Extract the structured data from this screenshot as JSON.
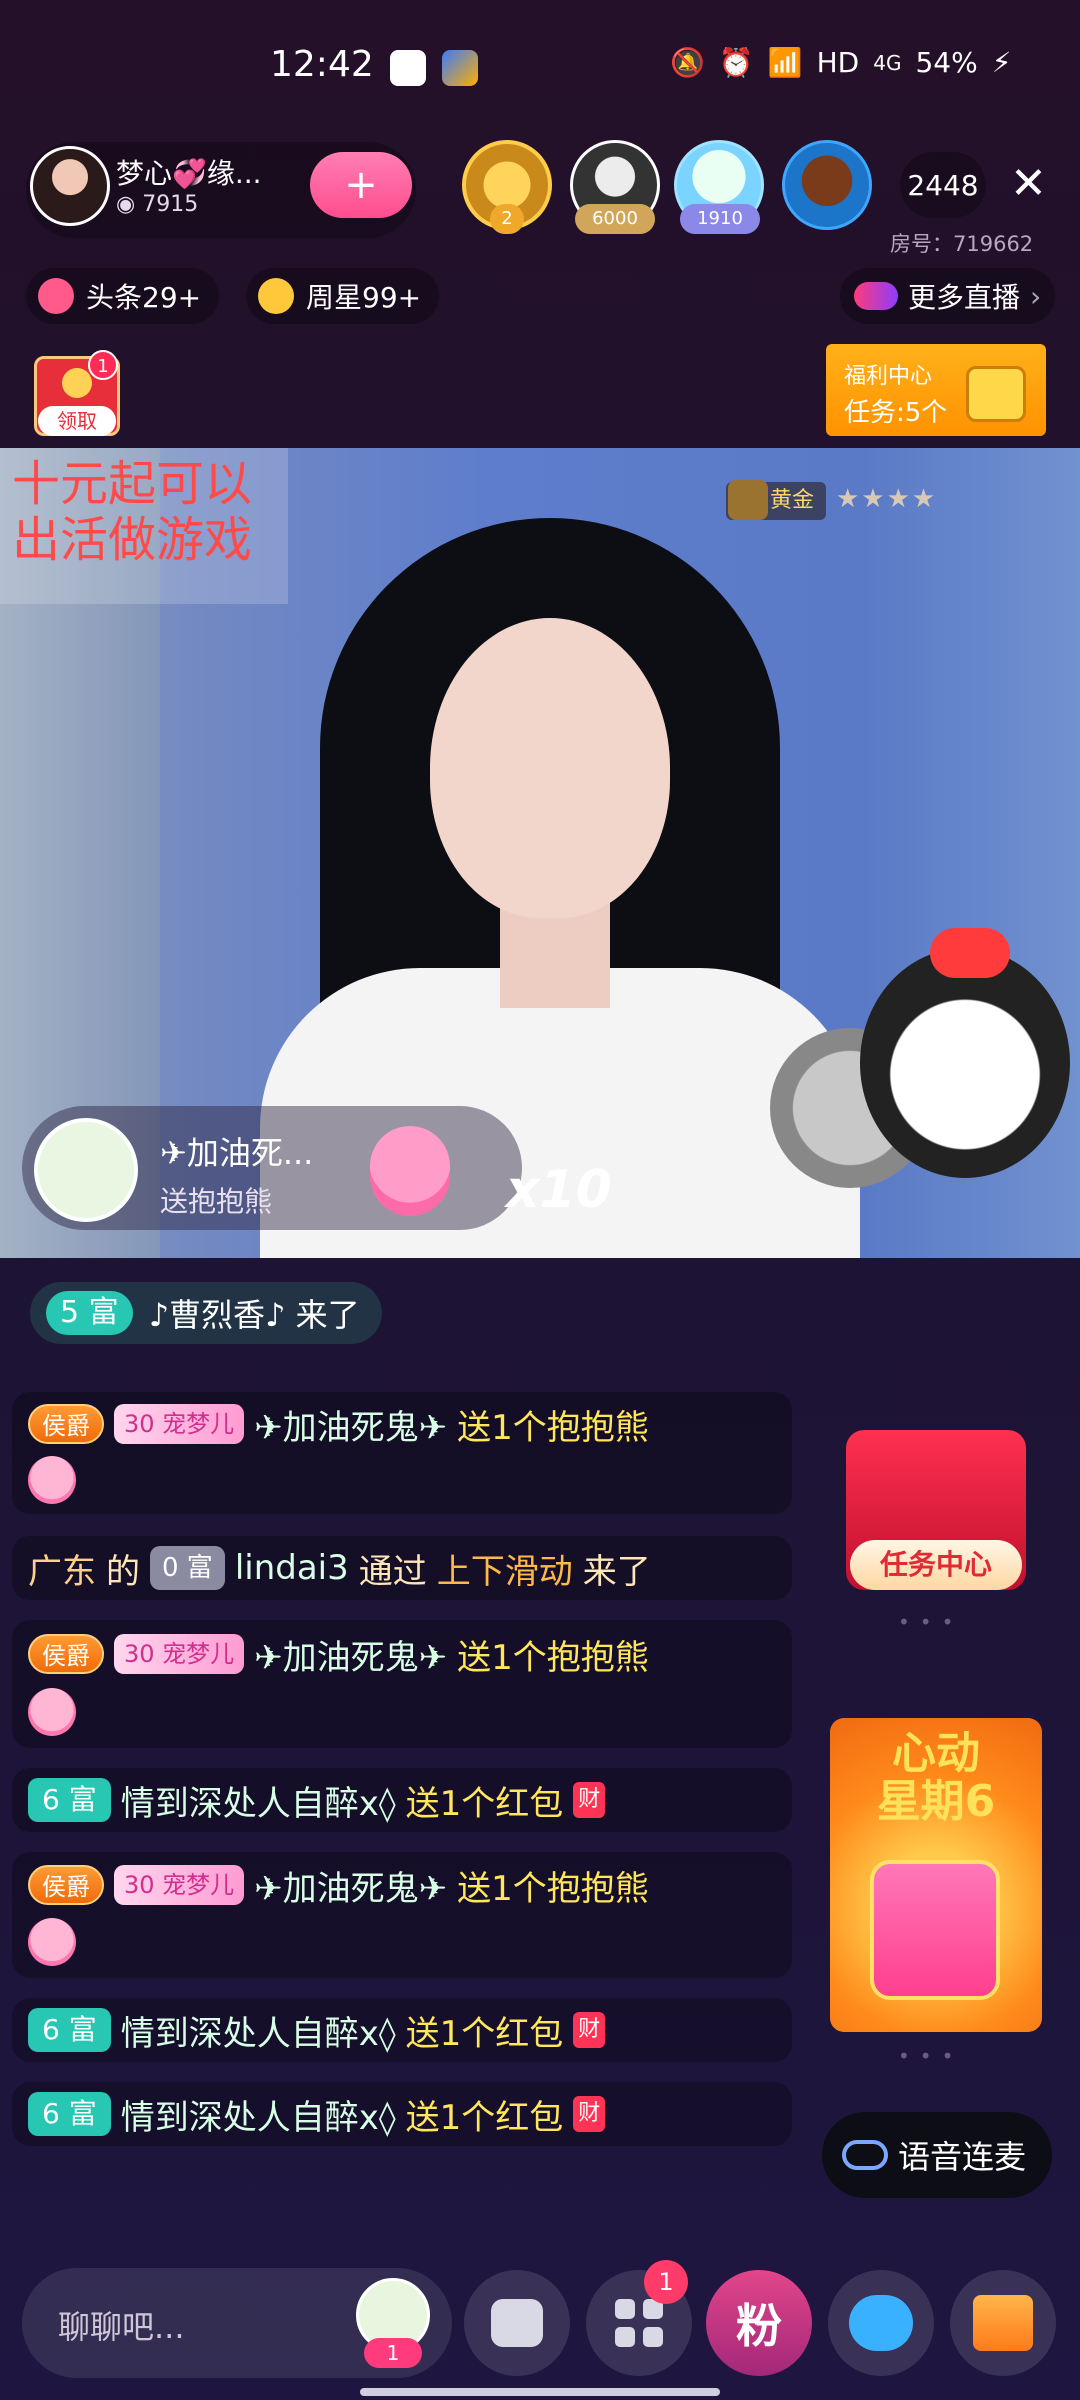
{
  "status_bar": {
    "time": "12:42",
    "network": "HD",
    "signal": "4G",
    "battery": "54%"
  },
  "host": {
    "name": "梦心💞缘...",
    "fans_count": "7915",
    "follow_icon": "+"
  },
  "top_viewers": [
    {
      "badge": "2"
    },
    {
      "badge": "6000"
    },
    {
      "badge": "1910"
    },
    {
      "badge": ""
    }
  ],
  "viewer_count": "2448",
  "room_number": "房号：719662",
  "rank_pills": {
    "toutiao": "头条29+",
    "zhouxing": "周星99+"
  },
  "more_live": "更多直播",
  "red_packet": {
    "label": "领取",
    "badge": "1"
  },
  "welfare": {
    "title": "福利中心",
    "tasks": "任务:5个"
  },
  "video": {
    "overlay_text_line1": "十元起可以",
    "overlay_text_line2": "出活做游戏",
    "level_badge": "黄金",
    "stars": "★★★★"
  },
  "gift_banner": {
    "user": "✈加油死...",
    "desc": "送抱抱熊",
    "count": "x10"
  },
  "join_banner": {
    "level": "5 富",
    "text": "♪曹烈香♪ 来了"
  },
  "chat": [
    {
      "type": "gift",
      "tag1": "侯爵",
      "tag2": "30 宠梦儿",
      "name": "✈加油死鬼✈",
      "action": "送1个抱抱熊"
    },
    {
      "type": "enter",
      "region": "广东",
      "of": "的",
      "level": "0 富",
      "name": "lindai3",
      "via": "通过",
      "method": "上下滑动",
      "suffix": "来了"
    },
    {
      "type": "gift",
      "tag1": "侯爵",
      "tag2": "30 宠梦儿",
      "name": "✈加油死鬼✈",
      "action": "送1个抱抱熊"
    },
    {
      "type": "red",
      "level": "6 富",
      "name": "情到深处人自醉x◊",
      "action": "送1个红包",
      "icon": "财"
    },
    {
      "type": "gift",
      "tag1": "侯爵",
      "tag2": "30 宠梦儿",
      "name": "✈加油死鬼✈",
      "action": "送1个抱抱熊"
    },
    {
      "type": "red",
      "level": "6 富",
      "name": "情到深处人自醉x◊",
      "action": "送1个红包",
      "icon": "财"
    },
    {
      "type": "red",
      "level": "6 富",
      "name": "情到深处人自醉x◊",
      "action": "送1个红包",
      "icon": "财"
    }
  ],
  "side": {
    "task_center": "任务中心",
    "heart_week_line1": "心动",
    "heart_week_line2": "星期6",
    "dots": "•••",
    "voice_mic": "语音连麦"
  },
  "bottom": {
    "placeholder": "聊聊吧...",
    "fan_badge": "1",
    "apps_badge": "1",
    "fans_label": "粉"
  }
}
